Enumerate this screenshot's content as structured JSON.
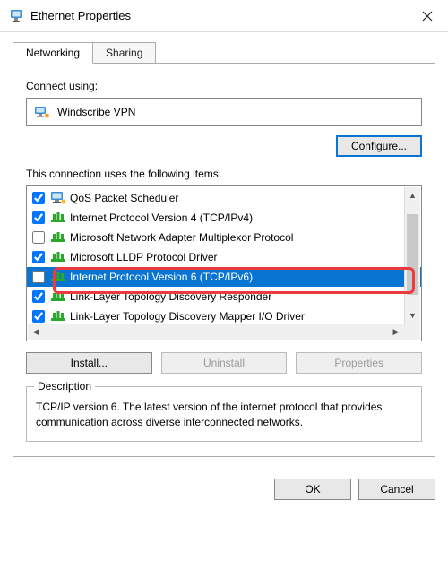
{
  "window": {
    "title": "Ethernet Properties"
  },
  "tabs": [
    {
      "label": "Networking",
      "active": true
    },
    {
      "label": "Sharing",
      "active": false
    }
  ],
  "connect_using_label": "Connect using:",
  "adapter": {
    "name": "Windscribe VPN"
  },
  "buttons": {
    "configure": "Configure...",
    "install": "Install...",
    "uninstall": "Uninstall",
    "properties": "Properties",
    "ok": "OK",
    "cancel": "Cancel"
  },
  "items_label": "This connection uses the following items:",
  "items": [
    {
      "checked": true,
      "icon": "monitor",
      "label": "QoS Packet Scheduler"
    },
    {
      "checked": true,
      "icon": "net",
      "label": "Internet Protocol Version 4 (TCP/IPv4)"
    },
    {
      "checked": false,
      "icon": "net",
      "label": "Microsoft Network Adapter Multiplexor Protocol"
    },
    {
      "checked": true,
      "icon": "net",
      "label": "Microsoft LLDP Protocol Driver"
    },
    {
      "checked": false,
      "icon": "net",
      "label": "Internet Protocol Version 6 (TCP/IPv6)",
      "selected": true
    },
    {
      "checked": true,
      "icon": "net",
      "label": "Link-Layer Topology Discovery Responder"
    },
    {
      "checked": true,
      "icon": "net",
      "label": "Link-Layer Topology Discovery Mapper I/O Driver"
    }
  ],
  "selected_index": 4,
  "description_legend": "Description",
  "description_text": "TCP/IP version 6. The latest version of the internet protocol that provides communication across diverse interconnected networks.",
  "uninstall_enabled": false,
  "properties_enabled": false
}
